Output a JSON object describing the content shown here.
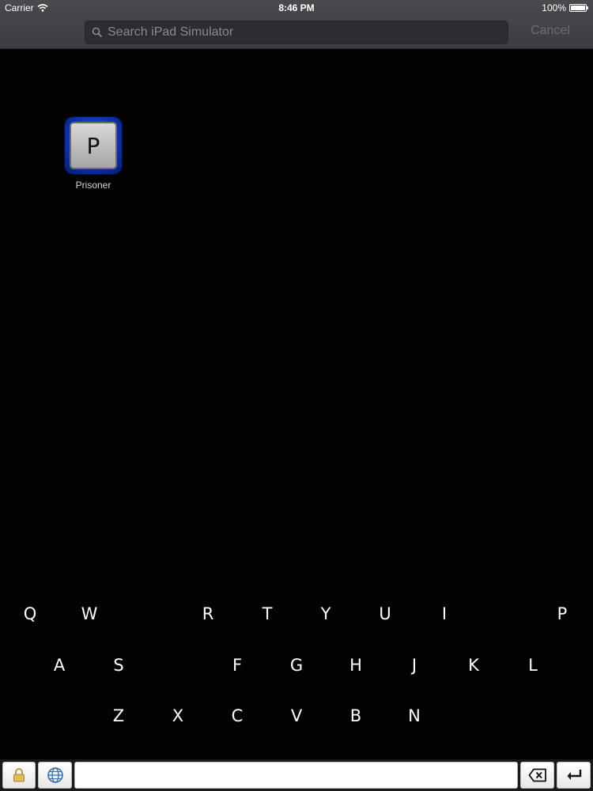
{
  "status_bar": {
    "carrier": "Carrier",
    "time": "8:46 PM",
    "battery_percent": "100%",
    "battery_level": 1.0
  },
  "search": {
    "placeholder": "Search iPad Simulator",
    "value": "",
    "cancel_label": "Cancel"
  },
  "apps": [
    {
      "label": "Prisoner",
      "icon_letter": "P",
      "icon": "prisoner-app-icon"
    }
  ],
  "keyboard": {
    "row1": [
      "Q",
      "W",
      "R",
      "T",
      "Y",
      "U",
      "I",
      "P"
    ],
    "row2": [
      "A",
      "S",
      "F",
      "G",
      "H",
      "J",
      "K",
      "L"
    ],
    "row3": [
      "Z",
      "X",
      "C",
      "V",
      "B",
      "N"
    ]
  },
  "bottom_bar": {
    "icons": [
      "lock-icon",
      "globe-icon",
      "delete-backspace-icon",
      "return-icon"
    ],
    "text_value": ""
  },
  "colors": {
    "background": "#030304",
    "topbar": "#444448",
    "app_icon_blue": "#1f4cff",
    "key_text": "#ffffff"
  }
}
